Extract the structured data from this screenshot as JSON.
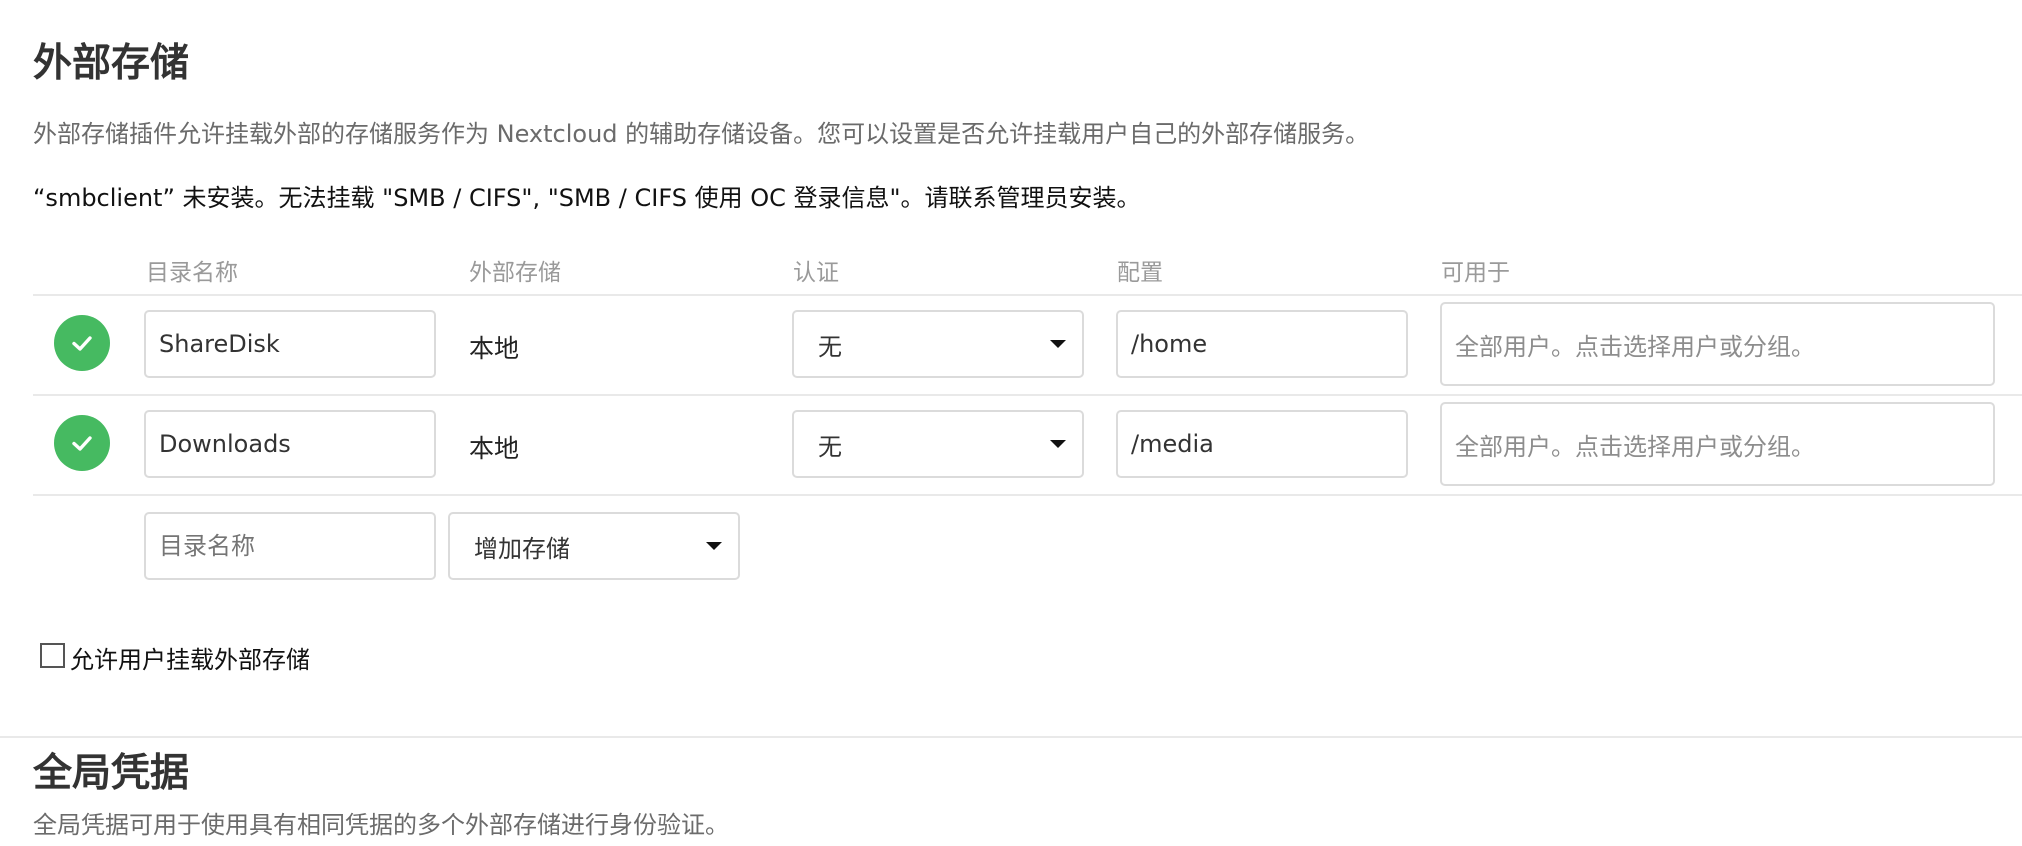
{
  "external_storage": {
    "title": "外部存储",
    "description": "外部存储插件允许挂载外部的存储服务作为 Nextcloud 的辅助存储设备。您可以设置是否允许挂载用户自己的外部存储服务。",
    "warning": "“smbclient” 未安装。无法挂载 \"SMB / CIFS\", \"SMB / CIFS 使用 OC 登录信息\"。请联系管理员安装。",
    "columns": [
      "目录名称",
      "外部存储",
      "认证",
      "配置",
      "可用于"
    ],
    "rows": [
      {
        "status": "ok",
        "status_icon": "check-icon",
        "folder_name": "ShareDisk",
        "backend": "本地",
        "auth": "无",
        "config": "/home",
        "applicable_placeholder": "全部用户。点击选择用户或分组。"
      },
      {
        "status": "ok",
        "status_icon": "check-icon",
        "folder_name": "Downloads",
        "backend": "本地",
        "auth": "无",
        "config": "/media",
        "applicable_placeholder": "全部用户。点击选择用户或分组。"
      }
    ],
    "new_row": {
      "folder_placeholder": "目录名称",
      "add_storage_label": "增加存储"
    },
    "allow_user_mounting_label": "允许用户挂载外部存储",
    "allow_user_mounting_checked": false,
    "status_color": "#46ba61"
  },
  "global_credentials": {
    "title": "全局凭据",
    "description": "全局凭据可用于使用具有相同凭据的多个外部存储进行身份验证。"
  }
}
